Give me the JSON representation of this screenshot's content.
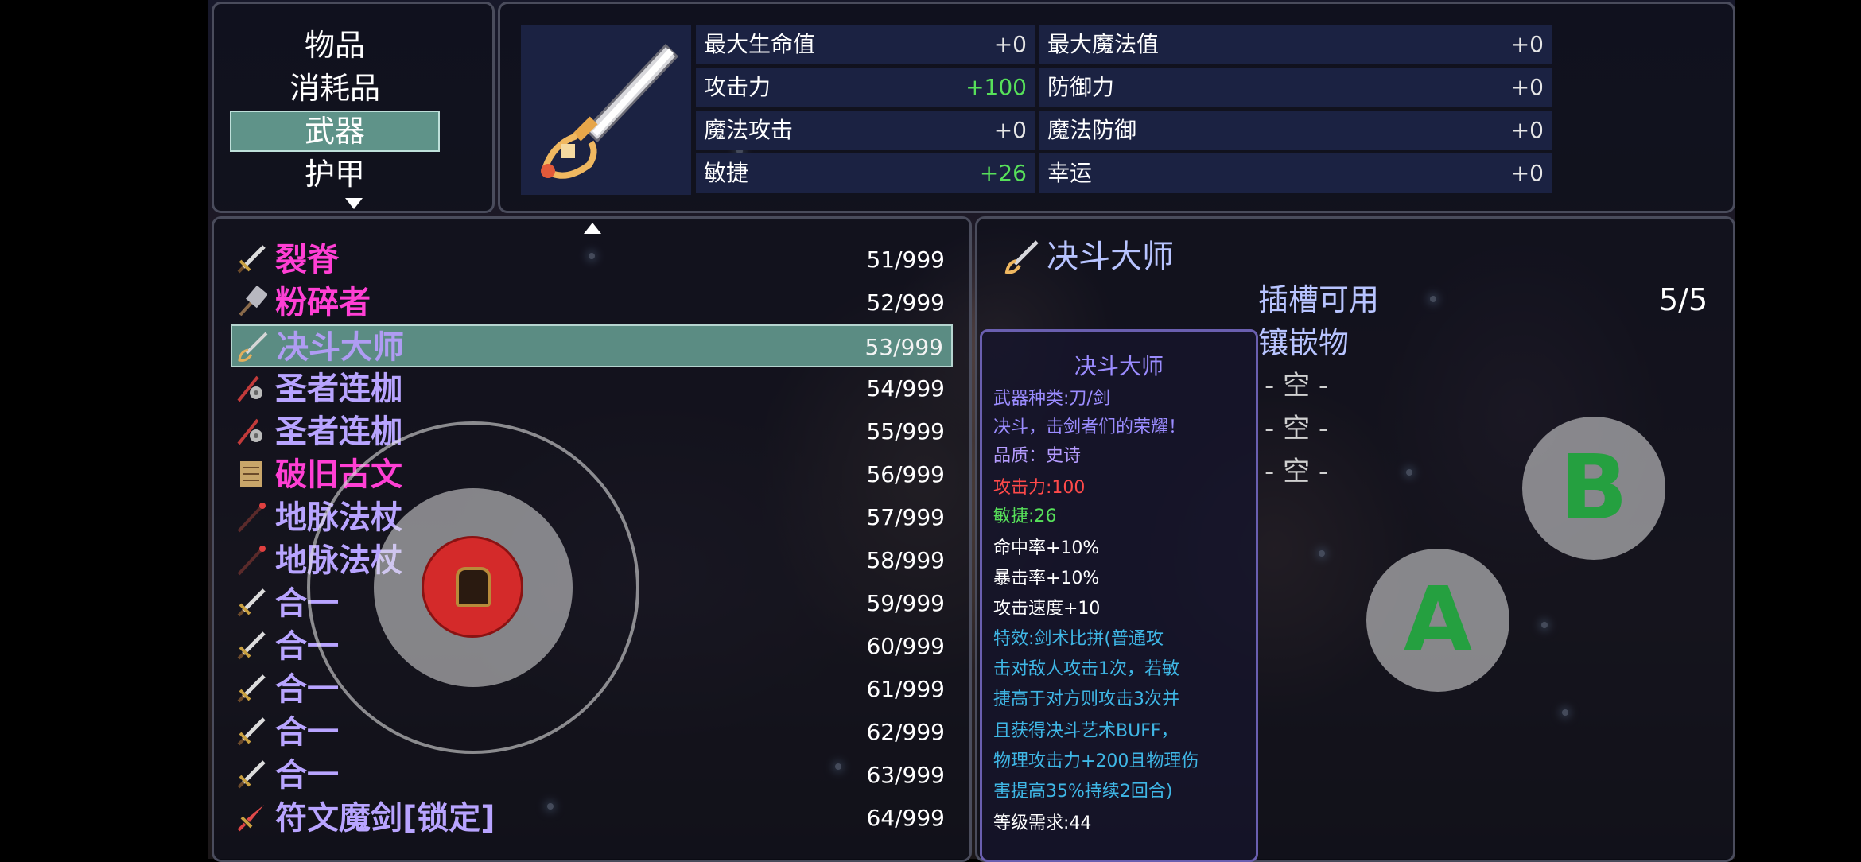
{
  "categories": {
    "items": [
      "物品",
      "消耗品",
      "武器",
      "护甲"
    ],
    "selected": "武器"
  },
  "stats": [
    {
      "name": "最大生命值",
      "value": "+0"
    },
    {
      "name": "最大魔法值",
      "value": "+0"
    },
    {
      "name": "攻击力",
      "value": "+100"
    },
    {
      "name": "防御力",
      "value": "+0"
    },
    {
      "name": "魔法攻击",
      "value": "+0"
    },
    {
      "name": "魔法防御",
      "value": "+0"
    },
    {
      "name": "敏捷",
      "value": "+26"
    },
    {
      "name": "幸运",
      "value": "+0"
    }
  ],
  "items": [
    {
      "name": "裂脊",
      "count": "51/999",
      "color": "#ff3fd4",
      "icon": "sword-icon"
    },
    {
      "name": "粉碎者",
      "count": "52/999",
      "color": "#ff3fd4",
      "icon": "hammer-icon"
    },
    {
      "name": "决斗大师",
      "count": "53/999",
      "color": "#b8a4ff",
      "icon": "rapier-icon"
    },
    {
      "name": "圣者连枷",
      "count": "54/999",
      "color": "#b8a4ff",
      "icon": "flail-icon"
    },
    {
      "name": "圣者连枷",
      "count": "55/999",
      "color": "#b8a4ff",
      "icon": "flail-icon"
    },
    {
      "name": "破旧古文",
      "count": "56/999",
      "color": "#ff3fd4",
      "icon": "scroll-icon"
    },
    {
      "name": "地脉法杖",
      "count": "57/999",
      "color": "#b8a4ff",
      "icon": "staff-icon"
    },
    {
      "name": "地脉法杖",
      "count": "58/999",
      "color": "#b8a4ff",
      "icon": "staff-icon"
    },
    {
      "name": "合一",
      "count": "59/999",
      "color": "#b8a4ff",
      "icon": "sword-icon"
    },
    {
      "name": "合一",
      "count": "60/999",
      "color": "#b8a4ff",
      "icon": "sword-icon"
    },
    {
      "name": "合一",
      "count": "61/999",
      "color": "#b8a4ff",
      "icon": "sword-icon"
    },
    {
      "name": "合一",
      "count": "62/999",
      "color": "#b8a4ff",
      "icon": "sword-icon"
    },
    {
      "name": "合一",
      "count": "63/999",
      "color": "#b8a4ff",
      "icon": "sword-icon"
    },
    {
      "name": "符文魔剑[锁定]",
      "count": "64/999",
      "color": "#b8a4ff",
      "icon": "rune-sword-icon"
    }
  ],
  "selected_index": 2,
  "detail": {
    "name": "决斗大师",
    "sockets_label": "插槽可用",
    "sockets_value": "5/5",
    "gems_label": "镶嵌物",
    "slots": [
      "- 空 -",
      "- 空 -",
      "- 空 -"
    ]
  },
  "tooltip": {
    "title": "决斗大师",
    "lines": [
      {
        "text": "武器种类:刀/剑",
        "color": "#9b8cff"
      },
      {
        "text": "决斗，击剑者们的荣耀！",
        "color": "#9b8cff"
      },
      {
        "text": "品质：史诗",
        "color": "#b59cff"
      },
      {
        "text": "攻击力:100",
        "color": "#ff4a4a"
      },
      {
        "text": "敏捷:26",
        "color": "#57e05a"
      },
      {
        "text": "命中率+10%",
        "color": "#ffffff"
      },
      {
        "text": "暴击率+10%",
        "color": "#ffffff"
      },
      {
        "text": "攻击速度+10",
        "color": "#ffffff"
      },
      {
        "text": "特效:剑术比拼(普通攻",
        "color": "#3fb7e6"
      },
      {
        "text": "击对敌人攻击1次，若敏",
        "color": "#3fb7e6"
      },
      {
        "text": "捷高于对方则攻击3次并",
        "color": "#3fb7e6"
      },
      {
        "text": "且获得决斗艺术BUFF，",
        "color": "#3fb7e6"
      },
      {
        "text": "物理攻击力+200且物理伤",
        "color": "#3fb7e6"
      },
      {
        "text": "害提高35%持续2回合)",
        "color": "#3fb7e6"
      },
      {
        "text": "等级需求:44",
        "color": "#ffffff"
      }
    ]
  },
  "buttons": {
    "a": "A",
    "b": "B"
  }
}
